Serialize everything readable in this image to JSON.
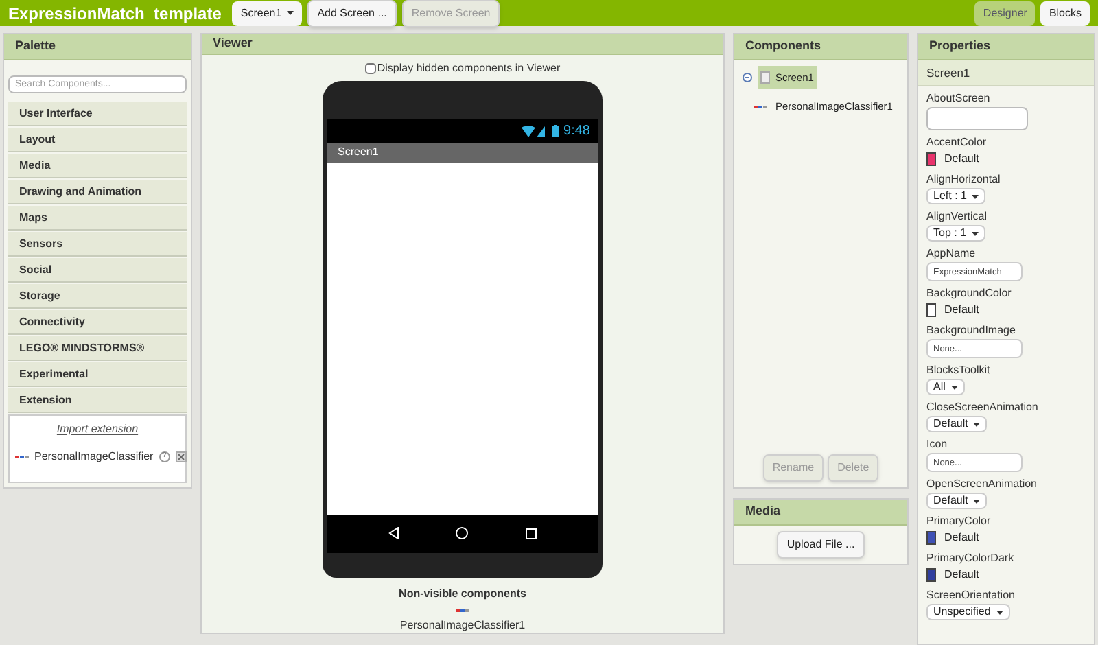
{
  "top_bar": {
    "title": "ExpressionMatch_template",
    "screen_dropdown": "Screen1",
    "buttons": [
      {
        "label": "Add Screen ...",
        "disabled": false
      },
      {
        "label": "Remove Screen",
        "disabled": true
      }
    ],
    "mode_buttons": [
      {
        "label": "Designer",
        "selected": true
      },
      {
        "label": "Blocks",
        "selected": false
      }
    ]
  },
  "palette": {
    "title": "Palette",
    "search": {
      "placeholder": "Search Components..."
    },
    "categories": [
      "User Interface",
      "Layout",
      "Media",
      "Drawing and Animation",
      "Maps",
      "Sensors",
      "Social",
      "Storage",
      "Connectivity",
      "LEGO® MINDSTORMS®",
      "Experimental",
      "Extension"
    ],
    "import_link": "Import extension",
    "extensions": [
      {
        "name": "PersonalImageClassifier",
        "help": "?"
      }
    ]
  },
  "viewer": {
    "title": "Viewer",
    "hidden_checkbox": {
      "label": "Display hidden components in Viewer",
      "checked": false
    },
    "phone": {
      "time": "9:48",
      "screen_title": "Screen1"
    },
    "non_visible_title": "Non-visible components",
    "non_visible": [
      "PersonalImageClassifier1"
    ]
  },
  "components": {
    "title": "Components",
    "tree": [
      {
        "label": "Screen1",
        "selected": true,
        "expanded": true,
        "children": [
          {
            "label": "PersonalImageClassifier1",
            "selected": false
          }
        ]
      }
    ],
    "buttons": [
      {
        "label": "Rename",
        "disabled": true
      },
      {
        "label": "Delete",
        "disabled": true
      }
    ]
  },
  "media": {
    "title": "Media",
    "upload_button": "Upload File ..."
  },
  "properties": {
    "title": "Properties",
    "component": "Screen1",
    "items": [
      {
        "label": "AboutScreen",
        "kind": "textarea",
        "value": ""
      },
      {
        "label": "AccentColor",
        "kind": "color",
        "value": "Default",
        "color": "#e8336b"
      },
      {
        "label": "AlignHorizontal",
        "kind": "dropdown",
        "value": "Left : 1"
      },
      {
        "label": "AlignVertical",
        "kind": "dropdown",
        "value": "Top : 1"
      },
      {
        "label": "AppName",
        "kind": "text",
        "value": "ExpressionMatch"
      },
      {
        "label": "BackgroundColor",
        "kind": "color",
        "value": "Default",
        "color": "#ffffff"
      },
      {
        "label": "BackgroundImage",
        "kind": "text",
        "value": "None..."
      },
      {
        "label": "BlocksToolkit",
        "kind": "dropdown",
        "value": "All"
      },
      {
        "label": "CloseScreenAnimation",
        "kind": "dropdown",
        "value": "Default"
      },
      {
        "label": "Icon",
        "kind": "text",
        "value": "None..."
      },
      {
        "label": "OpenScreenAnimation",
        "kind": "dropdown",
        "value": "Default"
      },
      {
        "label": "PrimaryColor",
        "kind": "color",
        "value": "Default",
        "color": "#3f51b5"
      },
      {
        "label": "PrimaryColorDark",
        "kind": "color",
        "value": "Default",
        "color": "#303f9f"
      },
      {
        "label": "ScreenOrientation",
        "kind": "dropdown",
        "value": "Unspecified"
      }
    ]
  }
}
